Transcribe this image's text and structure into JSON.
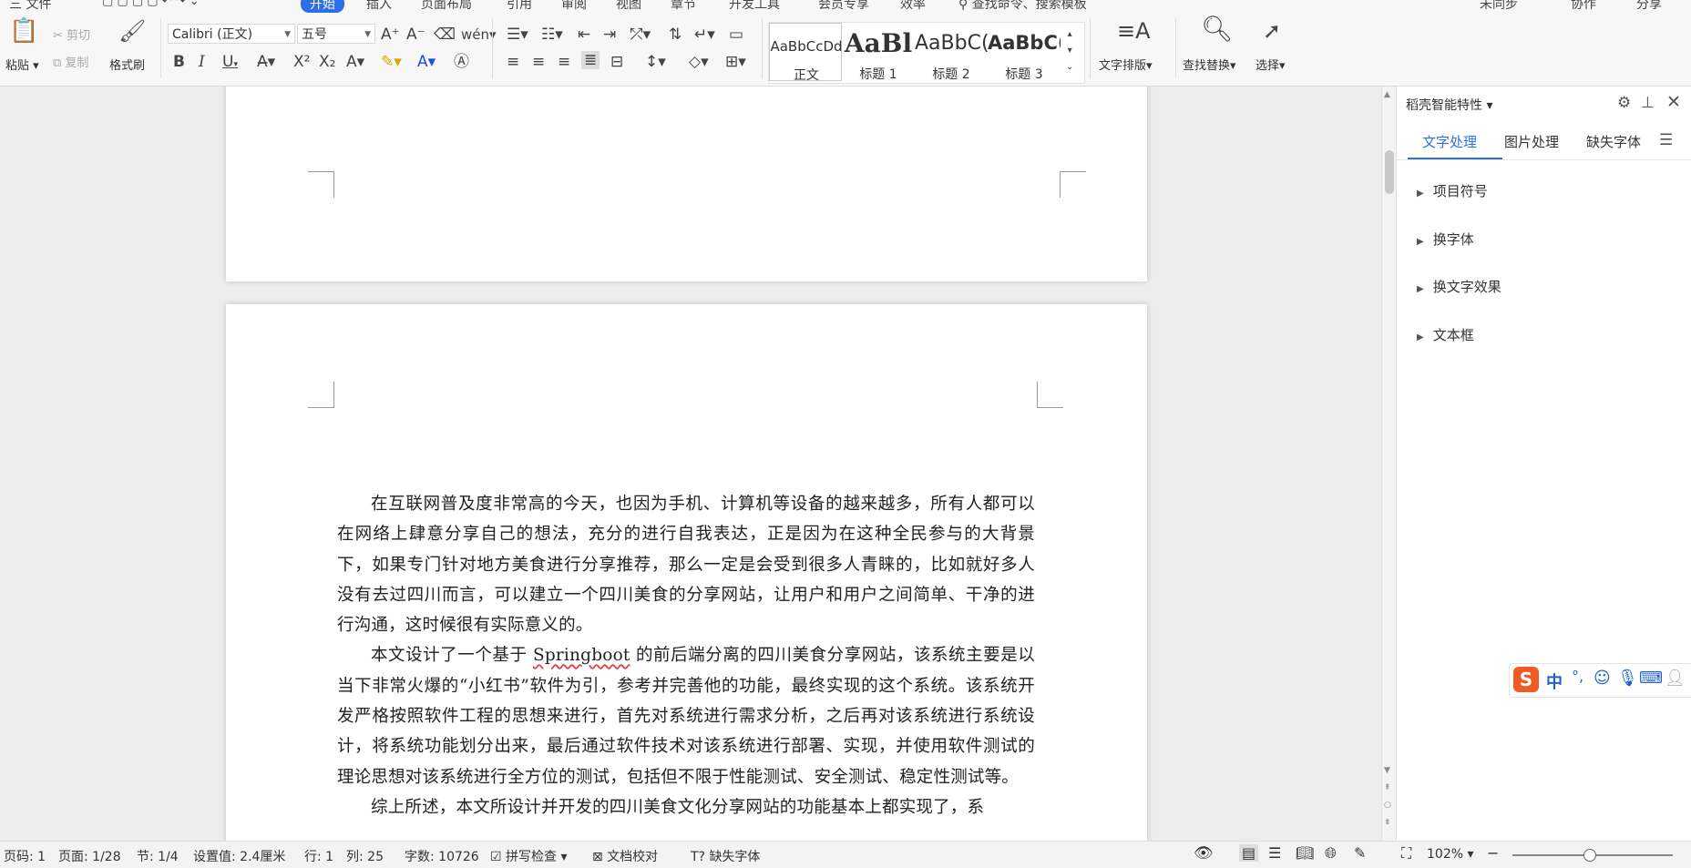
{
  "menubar": {
    "file": "三 文件",
    "active_tab": "开始",
    "tabs_partial": [
      "插入",
      "页面布局",
      "引用",
      "审阅",
      "视图",
      "章节",
      "开发工具",
      "会员专享",
      "效率"
    ],
    "search": "查找命令、搜索模板",
    "right": [
      "未同步",
      "协作",
      "分享"
    ]
  },
  "ribbon": {
    "paste": "粘贴",
    "cut": "剪切",
    "copy": "复制",
    "format_painter": "格式刷",
    "font_name": "Calibri (正文)",
    "font_size": "五号",
    "bold": "B",
    "italic": "I",
    "underline": "U",
    "styles": [
      {
        "preview": "AaBbCcDd",
        "label": "正文"
      },
      {
        "preview": "AaBl",
        "label": "标题 1"
      },
      {
        "preview": "AaBbC(",
        "label": "标题 2"
      },
      {
        "preview": "AaBbC(",
        "label": "标题 3"
      }
    ],
    "text_layout": "文字排版",
    "find_replace": "查找替换",
    "select": "选择"
  },
  "document": {
    "paragraphs": [
      "在互联网普及度非常高的今天，也因为手机、计算机等设备的越来越多，所有人都可以在网络上肆意分享自己的想法，充分的进行自我表达，正是因为在这种全民参与的大背景下，如果专门针对地方美食进行分享推荐，那么一定是会受到很多人青睐的，比如就好多人没有去过四川而言，可以建立一个四川美食的分享网站，让用户和用户之间简单、干净的进行沟通，这时候很有实际意义的。",
      "本文设计了一个基于 ",
      "Springboot",
      " 的前后端分离的四川美食分享网站，该系统主要是以当下非常火爆的“小红书”软件为引，参考并完善他的功能，最终实现的这个系统。该系统开发严格按照软件工程的思想来进行，首先对系统进行需求分析，之后再对该系统进行系统设计，将系统功能划分出来，最后通过软件技术对该系统进行部署、实现，并使用软件测试的理论思想对该系统进行全方位的测试，包括但不限于性能测试、安全测试、稳定性测试等。",
      "综上所述，本文所设计并开发的四川美食文化分享网站的功能基本上都实现了，系"
    ]
  },
  "panel": {
    "title": "稻壳智能特性",
    "tabs": [
      "文字处理",
      "图片处理",
      "缺失字体"
    ],
    "items": [
      "项目符号",
      "换字体",
      "换文字效果",
      "文本框"
    ]
  },
  "ime": {
    "mode": "中",
    "punct": "°,"
  },
  "status": {
    "page_num": "页码: 1",
    "pages": "页面: 1/28",
    "section": "节: 1/4",
    "setting": "设置值: 2.4厘米",
    "row": "行: 1",
    "col": "列: 25",
    "word_count": "字数: 10726",
    "spell": "拼写检查",
    "proofread": "文档校对",
    "missing_font": "缺失字体",
    "zoom": "102%"
  }
}
